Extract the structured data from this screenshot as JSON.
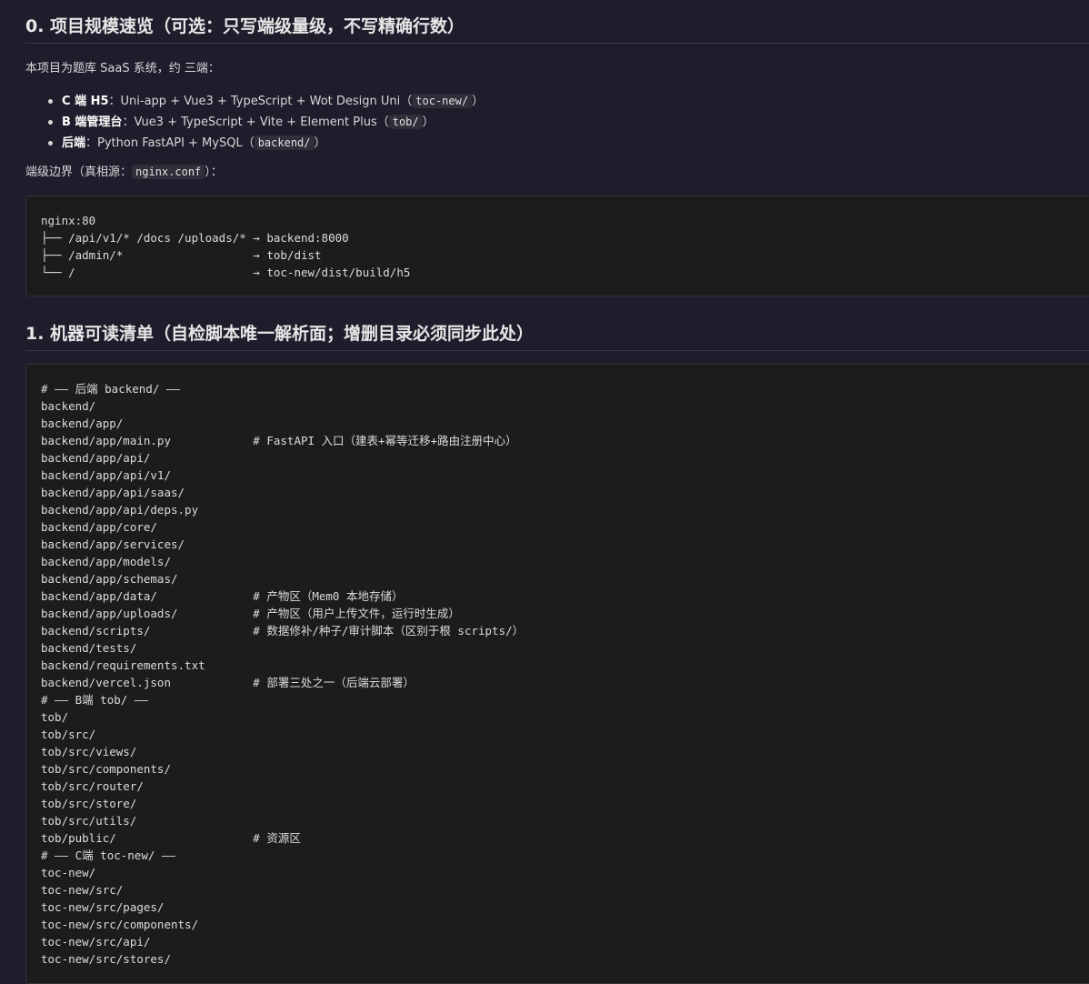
{
  "section0": {
    "title": "0. 项目规模速览（可选：只写端级量级，不写精确行数）",
    "intro": "本项目为题库 SaaS 系统，约 三端：",
    "items": [
      {
        "label": "C 端 H5",
        "text": "：Uni-app + Vue3 + TypeScript + Wot Design Uni（",
        "code": "toc-new/",
        "tail": "）"
      },
      {
        "label": "B 端管理台",
        "text": "：Vue3 + TypeScript + Vite + Element Plus（",
        "code": "tob/",
        "tail": "）"
      },
      {
        "label": "后端",
        "text": "：Python FastAPI + MySQL（",
        "code": "backend/",
        "tail": "）"
      }
    ],
    "boundary_prefix": "端级边界（真相源：",
    "boundary_code": "nginx.conf",
    "boundary_suffix": "）：",
    "nginx_lines": [
      "nginx:80",
      "├── /api/v1/* /docs /uploads/* → backend:8000",
      "├── /admin/*                   → tob/dist",
      "└── /                          → toc-new/dist/build/h5"
    ]
  },
  "section1": {
    "title": "1. 机器可读清单（自检脚本唯一解析面；增删目录必须同步此处）",
    "lines": [
      "# —— 后端 backend/ ——",
      "backend/",
      "backend/app/",
      "backend/app/main.py            # FastAPI 入口（建表+幂等迁移+路由注册中心）",
      "backend/app/api/",
      "backend/app/api/v1/",
      "backend/app/api/saas/",
      "backend/app/api/deps.py",
      "backend/app/core/",
      "backend/app/services/",
      "backend/app/models/",
      "backend/app/schemas/",
      "backend/app/data/              # 产物区（Mem0 本地存储）",
      "backend/app/uploads/           # 产物区（用户上传文件，运行时生成）",
      "backend/scripts/               # 数据修补/种子/审计脚本（区别于根 scripts/）",
      "backend/tests/",
      "backend/requirements.txt",
      "backend/vercel.json            # 部署三处之一（后端云部署）",
      "# —— B端 tob/ ——",
      "tob/",
      "tob/src/",
      "tob/src/views/",
      "tob/src/components/",
      "tob/src/router/",
      "tob/src/store/",
      "tob/src/utils/",
      "tob/public/                    # 资源区",
      "# —— C端 toc-new/ ——",
      "toc-new/",
      "toc-new/src/",
      "toc-new/src/pages/",
      "toc-new/src/components/",
      "toc-new/src/api/",
      "toc-new/src/stores/"
    ]
  }
}
